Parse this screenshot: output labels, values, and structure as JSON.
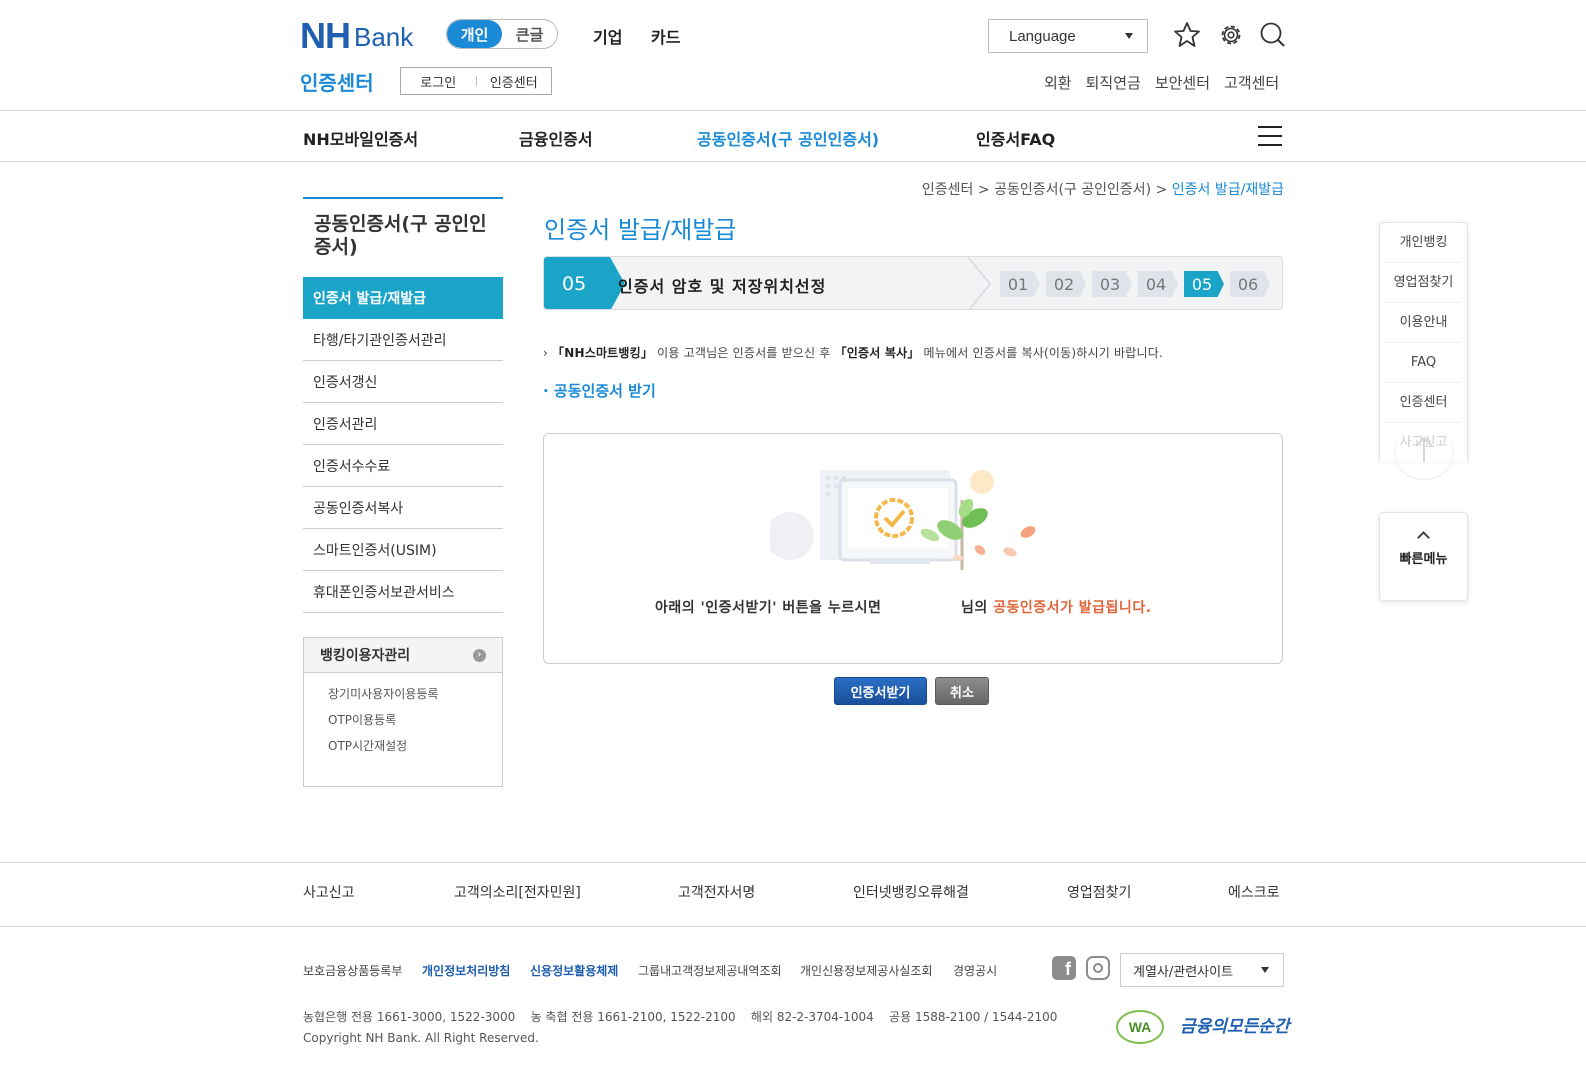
{
  "header": {
    "logo_nh": "NH",
    "logo_bank": "Bank",
    "segment": [
      "개인",
      "큰글"
    ],
    "nav": [
      "기업",
      "카드"
    ],
    "language": "Language",
    "cert_title": "인증센터",
    "mini": [
      "로그인",
      "인증센터"
    ],
    "utility": [
      "외환",
      "퇴직연금",
      "보안센터",
      "고객센터"
    ]
  },
  "gnb": [
    "NH모바일인증서",
    "금융인증서",
    "공동인증서(구 공인인증서)",
    "인증서FAQ"
  ],
  "lnb": {
    "title": "공동인증서(구 공인인증서)",
    "items": [
      "인증서 발급/재발급",
      "타행/타기관인증서관리",
      "인증서갱신",
      "인증서관리",
      "인증서수수료",
      "공동인증서복사",
      "스마트인증서(USIM)",
      "휴대폰인증서보관서비스"
    ],
    "sub_title": "뱅킹이용자관리",
    "sub_items": [
      "장기미사용자이용등록",
      "OTP이용등록",
      "OTP시간재설정"
    ]
  },
  "breadcrumb": [
    "인증센터",
    "공동인증서(구 공인인증서)",
    "인증서 발급/재발급"
  ],
  "page_title": "인증서 발급/재발급",
  "step": {
    "current": "05",
    "name": "인증서 암호 및 저장위치선정",
    "list": [
      "01",
      "02",
      "03",
      "04",
      "05",
      "06"
    ]
  },
  "notice": {
    "pre": "「NH스마트뱅킹」",
    "mid": " 이용 고객님은 인증서를 받으신 후 ",
    "menu": "「인증서 복사」",
    "post": " 메뉴에서 인증서를 복사(이동)하시기 바랍니다."
  },
  "section_heading": "공동인증서 받기",
  "panel": {
    "msg1": "아래의 '인증서받기' 버튼을 누르시면",
    "msg2": "님의",
    "msg_highlight": "공동인증서가 발급됩니다."
  },
  "buttons": {
    "receive": "인증서받기",
    "cancel": "취소"
  },
  "quick": {
    "items": [
      "개인뱅킹",
      "영업점찾기",
      "이용안내",
      "FAQ",
      "인증센터",
      "사고신고"
    ],
    "fast_menu": "빠른메뉴"
  },
  "footer": {
    "nav": [
      "사고신고",
      "고객의소리[전자민원]",
      "고객전자서명",
      "인터넷뱅킹오류해결",
      "영업점찾기",
      "에스크로"
    ],
    "links": [
      "보호금융상품등록부",
      "개인정보처리방침",
      "신용정보활용체제",
      "그룹내고객정보제공내역조회",
      "개인신용정보제공사실조회",
      "경영공시"
    ],
    "contact": "농협은행 전용 1661-3000, 1522-3000    농 축협 전용 1661-2100, 1522-2100    해외 82-2-3704-1004    공용 1588-2100 / 1544-2100",
    "copyright": "Copyright NH Bank. All Right Reserved.",
    "family_select": "계열사/관련사이트",
    "wa_mark": "WA",
    "slogan": "금융의모든순간"
  }
}
